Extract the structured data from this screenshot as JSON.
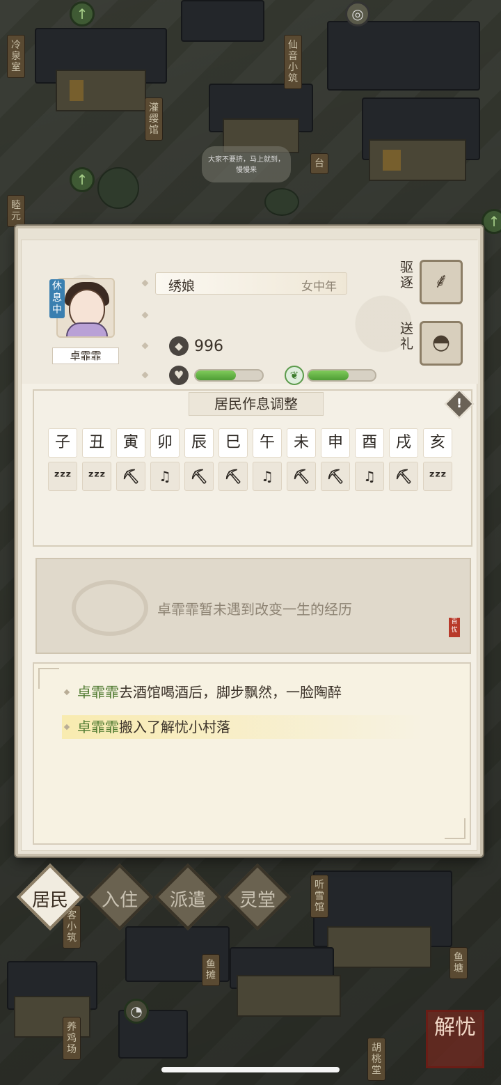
{
  "map_labels": [
    "冷泉室",
    "仙音小筑",
    "灌缨馆",
    "台",
    "睦元",
    "听雪馆",
    "鱼摊",
    "鱼塘",
    "养鸡场",
    "胡桃堂",
    "客小筑"
  ],
  "speech_bubble": "大家不要挤，马上就到，慢慢来",
  "resident": {
    "name": "卓霏霏",
    "status_badge": "休息中",
    "job": "绣娘",
    "gender_age": "女中年",
    "coins": "996",
    "health_level": 0.6,
    "growth_level": 0.6
  },
  "actions": {
    "expel": "驱逐",
    "gift": "送礼"
  },
  "schedule": {
    "title": "居民作息调整",
    "hours": [
      "子",
      "丑",
      "寅",
      "卯",
      "辰",
      "巳",
      "午",
      "未",
      "申",
      "酉",
      "戌",
      "亥"
    ],
    "activities": [
      "sleep",
      "sleep",
      "work",
      "music",
      "work",
      "work",
      "music",
      "work",
      "work",
      "music",
      "work",
      "sleep"
    ],
    "activity_glyphs": {
      "sleep": "ᶻᶻᶻ",
      "work": "⛏",
      "music": "♫"
    }
  },
  "life_event": "卓霏霏暂未遇到改变一生的经历",
  "log": [
    {
      "name": "卓霏霏",
      "text": "去酒馆喝酒后，脚步飘然，一脸陶醉"
    },
    {
      "name": "卓霏霏",
      "text": "搬入了解忧小村落"
    }
  ],
  "tabs": [
    "居民",
    "入住",
    "派遣",
    "灵堂"
  ],
  "corner_badge": "解忧",
  "colors": {
    "accent_green": "#4e9d35",
    "panel_bg": "#f4f0e6",
    "badge_blue": "#3a7fb0"
  }
}
